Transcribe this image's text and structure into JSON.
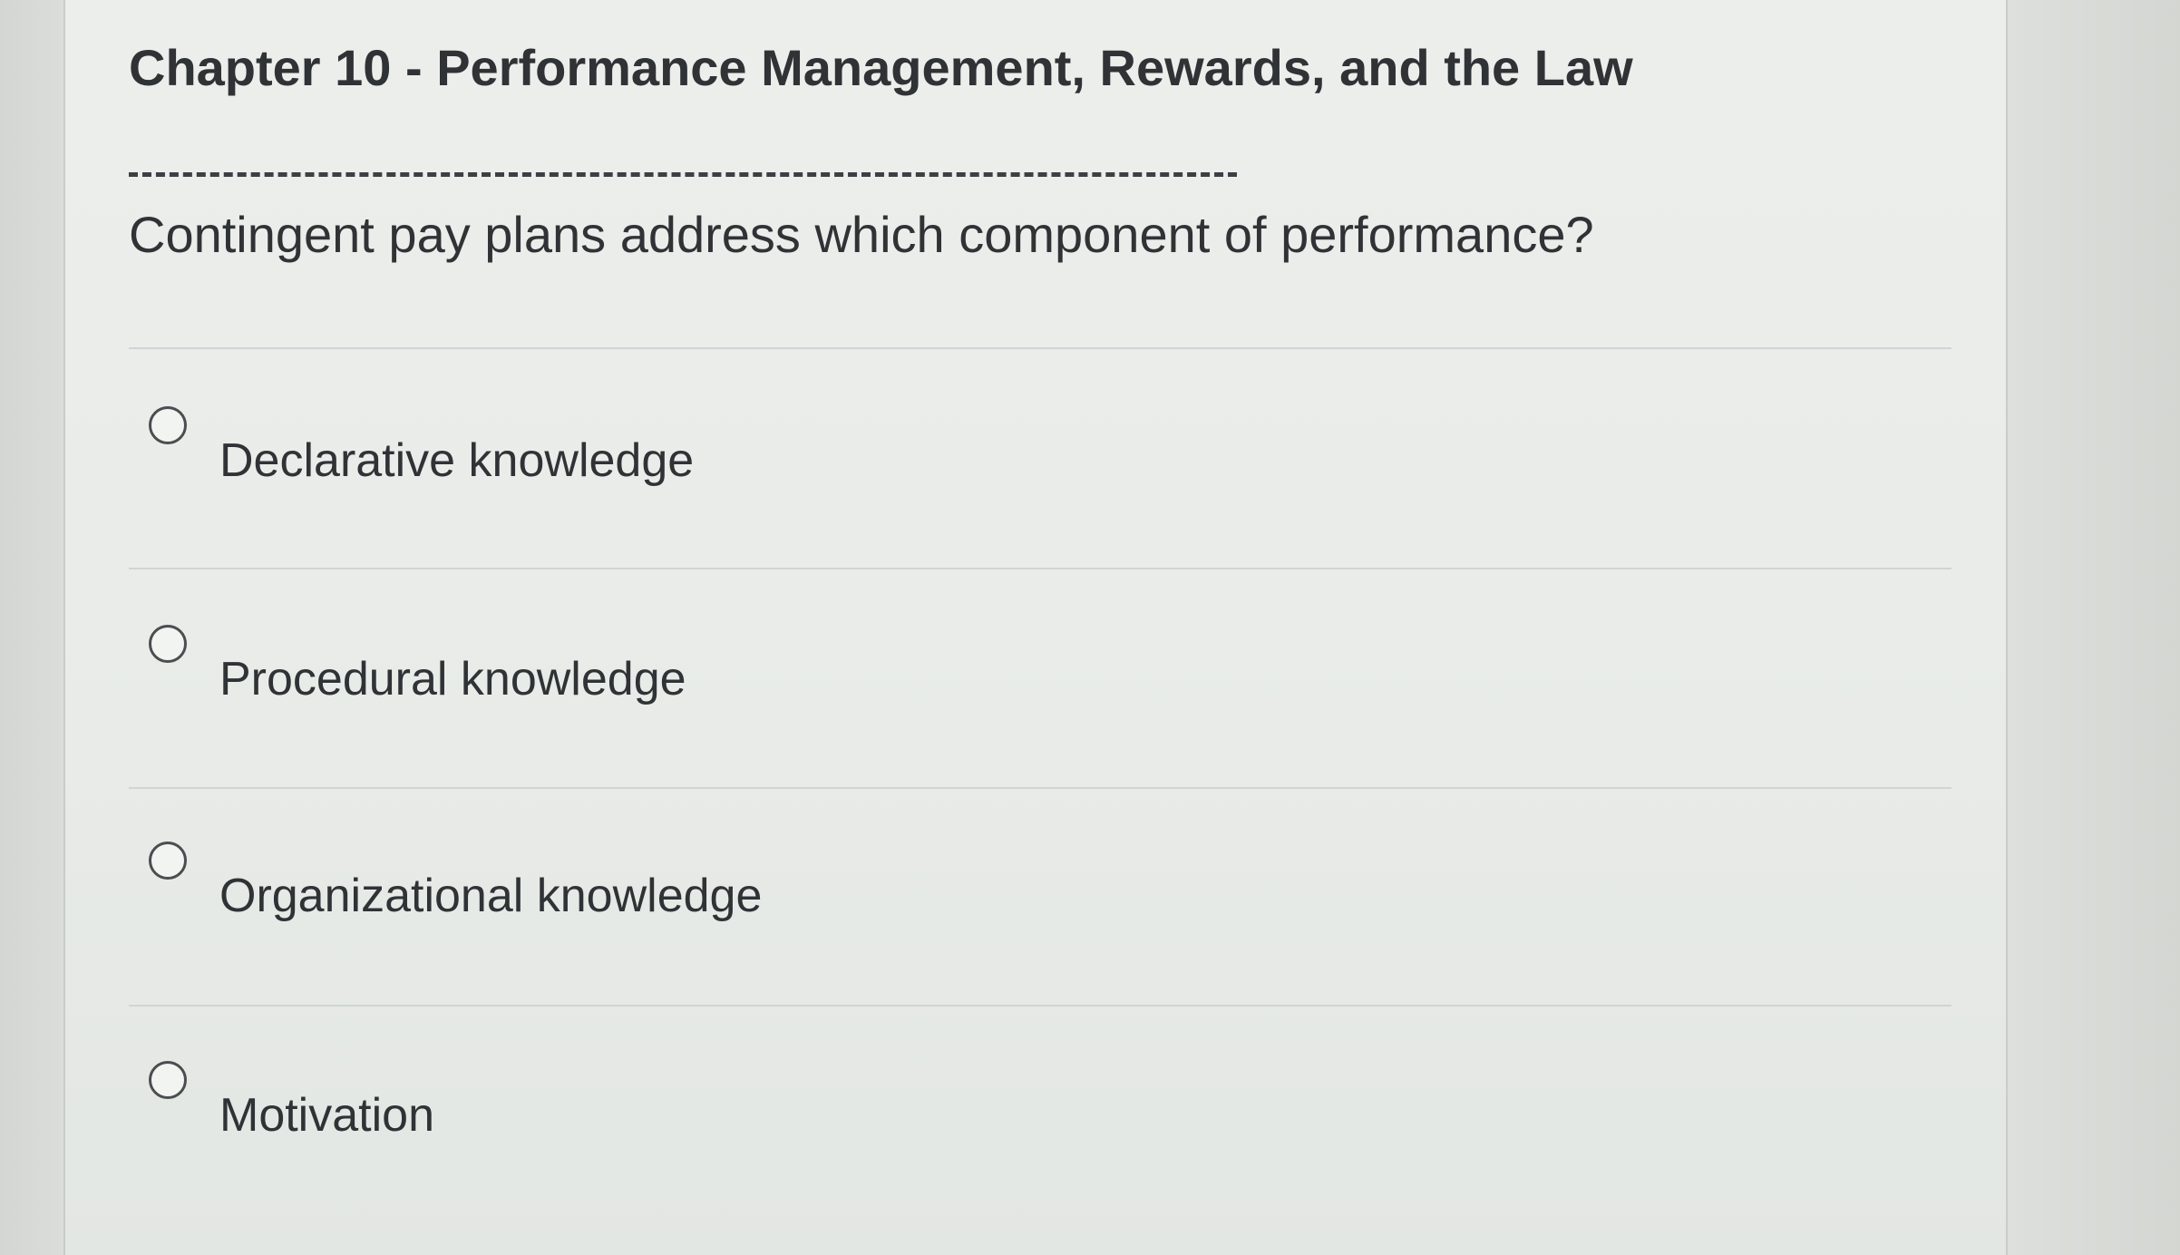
{
  "quiz": {
    "chapter_title": "Chapter 10 - Performance Management, Rewards, and the Law",
    "question": "Contingent pay plans address which component of performance?",
    "options": [
      {
        "label": "Declarative knowledge",
        "selected": false
      },
      {
        "label": "Procedural knowledge",
        "selected": false
      },
      {
        "label": "Organizational knowledge",
        "selected": false
      },
      {
        "label": "Motivation",
        "selected": false
      }
    ]
  },
  "colors": {
    "text": "#2f3336",
    "divider": "#cfd5d6",
    "background": "#e9ece9"
  }
}
